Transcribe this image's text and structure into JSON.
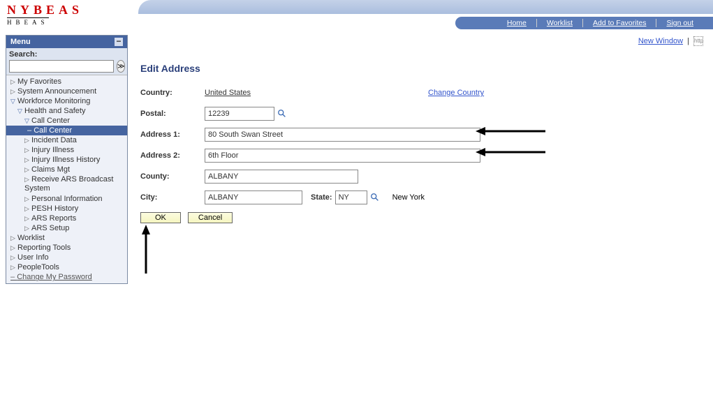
{
  "header": {
    "logo_main": "NYBEAS",
    "logo_sub": "HBEAS",
    "nav": {
      "home": "Home",
      "worklist": "Worklist",
      "favorites": "Add to Favorites",
      "signout": "Sign out"
    }
  },
  "sidebar": {
    "menu_title": "Menu",
    "search_label": "Search:",
    "items": {
      "fav": "My Favorites",
      "sysann": "System Announcement",
      "wf": "Workforce Monitoring",
      "hs": "Health and Safety",
      "cc": "Call Center",
      "cc_sel": "Call Center",
      "incident": "Incident Data",
      "injill": "Injury Illness",
      "injhist": "Injury Illness History",
      "claims": "Claims Mgt",
      "ars": "Receive ARS Broadcast System",
      "pinfo": "Personal Information",
      "pesh": "PESH History",
      "arsrep": "ARS Reports",
      "arssetup": "ARS Setup",
      "worklist": "Worklist",
      "reporting": "Reporting Tools",
      "userinfo": "User Info",
      "people": "PeopleTools",
      "changepw": "Change My Password"
    }
  },
  "content": {
    "new_window": "New Window",
    "title": "Edit Address",
    "labels": {
      "country": "Country:",
      "postal": "Postal:",
      "addr1": "Address 1:",
      "addr2": "Address 2:",
      "county": "County:",
      "city": "City:",
      "state": "State:"
    },
    "values": {
      "country": "United States",
      "change_country": "Change Country",
      "postal": "12239",
      "addr1": "80 South Swan Street",
      "addr2": "6th Floor",
      "county": "ALBANY",
      "city": "ALBANY",
      "state": "NY",
      "state_name": "New York"
    },
    "buttons": {
      "ok": "OK",
      "cancel": "Cancel"
    }
  }
}
